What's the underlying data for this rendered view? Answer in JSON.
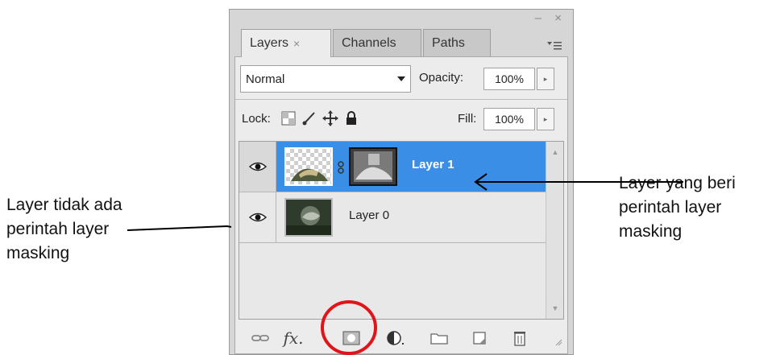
{
  "panel": {
    "tabs": [
      {
        "label": "Layers",
        "close": "×"
      },
      {
        "label": "Channels"
      },
      {
        "label": "Paths"
      }
    ],
    "window_controls": "– ×",
    "blend_mode": "Normal",
    "opacity_label": "Opacity:",
    "opacity_value": "100%",
    "lock_label": "Lock:",
    "fill_label": "Fill:",
    "fill_value": "100%",
    "layers": [
      {
        "name": "Layer 1",
        "selected": true,
        "has_mask": true
      },
      {
        "name": "Layer 0",
        "selected": false,
        "has_mask": false
      }
    ],
    "bottom_icons": [
      "link-layers-icon",
      "fx-icon",
      "add-layer-mask-icon",
      "adjustment-layer-icon",
      "new-group-icon",
      "new-layer-icon",
      "trash-icon"
    ],
    "fx_label": "fx."
  },
  "annotations": {
    "left_lines": [
      "Layer tidak ada",
      "perintah layer",
      "masking"
    ],
    "right_lines": [
      "Layer yang beri",
      "perintah layer",
      "masking"
    ]
  },
  "highlight_color": "#e0141b",
  "selection_color": "#3b8ee6"
}
